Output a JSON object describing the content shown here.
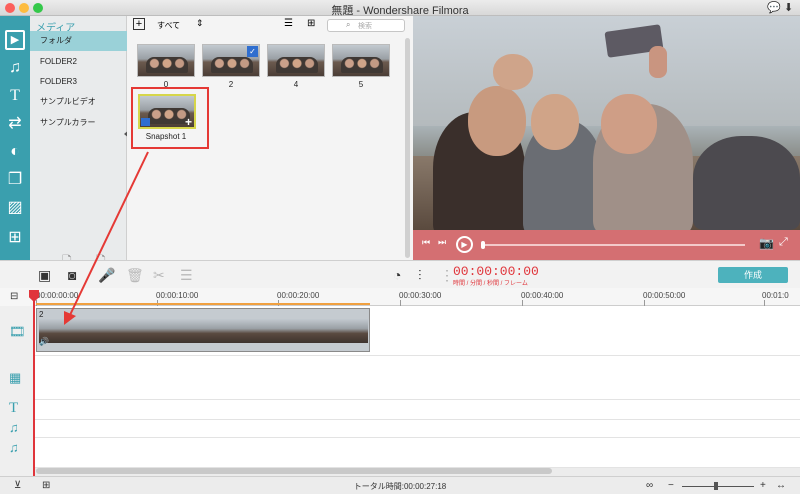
{
  "window": {
    "title": "無題 - Wondershare Filmora"
  },
  "sidebar": {
    "active_icon": "media-icon"
  },
  "folders": {
    "header": "メディア",
    "items": [
      {
        "label": "フォルダ",
        "selected": true
      },
      {
        "label": "FOLDER2",
        "selected": false
      },
      {
        "label": "FOLDER3",
        "selected": false
      },
      {
        "label": "サンプルビデオ",
        "selected": false
      },
      {
        "label": "サンプルカラー",
        "selected": false
      }
    ]
  },
  "media": {
    "filter": "すべて",
    "search_placeholder": "検索",
    "thumbs": [
      {
        "label": "0"
      },
      {
        "label": "2"
      },
      {
        "label": "4"
      },
      {
        "label": "5"
      },
      {
        "label": "Snapshot 1"
      }
    ]
  },
  "toolbar": {
    "timecode": "00:00:00:00",
    "timecode_sub": "時間 / 分間 / 秒間 / フレーム",
    "export_label": "作成"
  },
  "timeline": {
    "ruler": [
      "00:00:00:00",
      "00:00:10:00",
      "00:00:20:00",
      "00:00:30:00",
      "00:00:40:00",
      "00:00:50:00",
      "00:01:0"
    ],
    "clip_label": "2"
  },
  "status": {
    "total_time": "トータル時間:00:00:27:18"
  },
  "colors": {
    "accent": "#3a9fae",
    "timecode": "#e0353b",
    "annotation": "#e53935",
    "player_bar": "#d46f72"
  }
}
